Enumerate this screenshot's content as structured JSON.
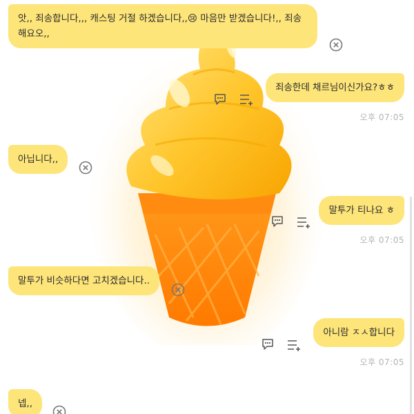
{
  "colors": {
    "bubble": "#fde57a",
    "time": "#b3b3b3",
    "icon": "#777777"
  },
  "background": {
    "image": "orange-soft-serve-ice-cream-cone"
  },
  "messages": [
    {
      "side": "left",
      "text": "앗,, 죄송합니다,,, 캐스팅 거절 하겠습니다,,😢 마음만 받겠습니다!,, 죄송해요오,,",
      "icon": "close-icon"
    },
    {
      "side": "right",
      "text": "죄송한데 채르님이신가요?ㅎㅎ",
      "time": "오후 07:05",
      "icons": [
        "comment-icon",
        "list-add-icon"
      ]
    },
    {
      "side": "left",
      "text": "아닙니다,,",
      "icon": "close-icon"
    },
    {
      "side": "right",
      "text": "말투가 티나요 ㅎ",
      "time": "오후 07:05",
      "icons": [
        "comment-icon",
        "list-add-icon"
      ]
    },
    {
      "side": "left",
      "text": "말투가 비슷하다면 고치겠습니다..",
      "icon": "close-icon"
    },
    {
      "side": "right",
      "text": "아니람 ㅈㅅ합니다",
      "time": "오후 07:05",
      "icons": [
        "comment-icon",
        "list-add-icon"
      ]
    },
    {
      "side": "left",
      "text": "넵,,",
      "icon": "close-icon"
    }
  ]
}
